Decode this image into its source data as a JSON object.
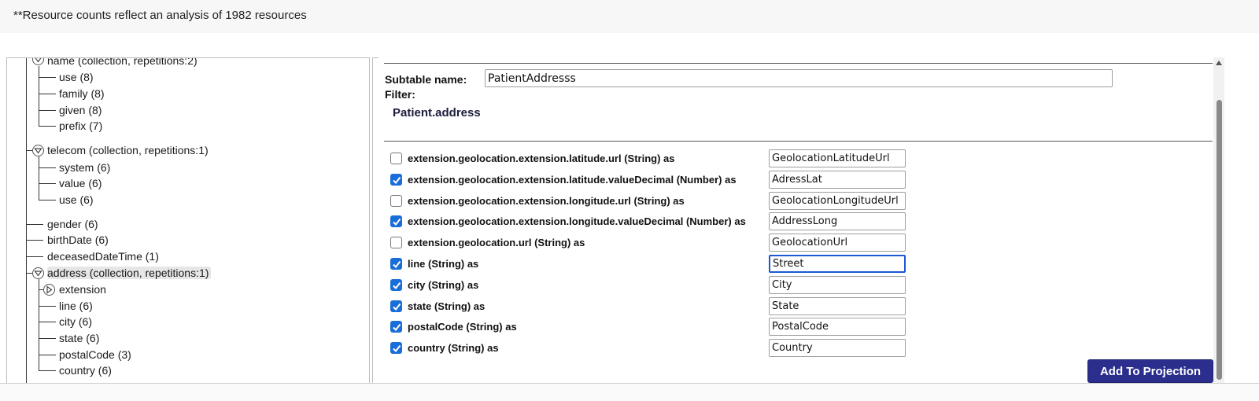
{
  "banner": {
    "text": "**Resource counts reflect an analysis of 1982 resources"
  },
  "tree": {
    "nodes": [
      {
        "label": "name (collection, repetitions:2)"
      },
      {
        "label": "use (8)"
      },
      {
        "label": "family (8)"
      },
      {
        "label": "given (8)"
      },
      {
        "label": "prefix (7)"
      },
      {
        "label": "telecom (collection, repetitions:1)"
      },
      {
        "label": "system (6)"
      },
      {
        "label": "value (6)"
      },
      {
        "label": "use (6)"
      },
      {
        "label": "gender (6)"
      },
      {
        "label": "birthDate (6)"
      },
      {
        "label": "deceasedDateTime (1)"
      },
      {
        "label": "address (collection, repetitions:1)"
      },
      {
        "label": "extension"
      },
      {
        "label": "line (6)"
      },
      {
        "label": "city (6)"
      },
      {
        "label": "state (6)"
      },
      {
        "label": "postalCode (3)"
      },
      {
        "label": "country (6)"
      }
    ]
  },
  "subtable": {
    "name_label": "Subtable name:",
    "name_value": "PatientAddresss",
    "filter_label": "Filter:",
    "filter_value": "Patient.address"
  },
  "fields": [
    {
      "label": "extension.geolocation.extension.latitude.url (String) as",
      "checked": false,
      "alias": "GeolocationLatitudeUrl"
    },
    {
      "label": "extension.geolocation.extension.latitude.valueDecimal (Number) as",
      "checked": true,
      "alias": "AdressLat"
    },
    {
      "label": "extension.geolocation.extension.longitude.url (String) as",
      "checked": false,
      "alias": "GeolocationLongitudeUrl"
    },
    {
      "label": "extension.geolocation.extension.longitude.valueDecimal (Number) as",
      "checked": true,
      "alias": "AddressLong"
    },
    {
      "label": "extension.geolocation.url (String) as",
      "checked": false,
      "alias": "GeolocationUrl"
    },
    {
      "label": "line (String) as",
      "checked": true,
      "alias": "Street"
    },
    {
      "label": "city (String) as",
      "checked": true,
      "alias": "City"
    },
    {
      "label": "state (String) as",
      "checked": true,
      "alias": "State"
    },
    {
      "label": "postalCode (String) as",
      "checked": true,
      "alias": "PostalCode"
    },
    {
      "label": "country (String) as",
      "checked": true,
      "alias": "Country"
    }
  ],
  "actions": {
    "add_label": "Add To Projection"
  },
  "colors": {
    "accent": "#2b2e8c",
    "checkbox": "#1a6ed8",
    "focus": "#1c57d6"
  }
}
